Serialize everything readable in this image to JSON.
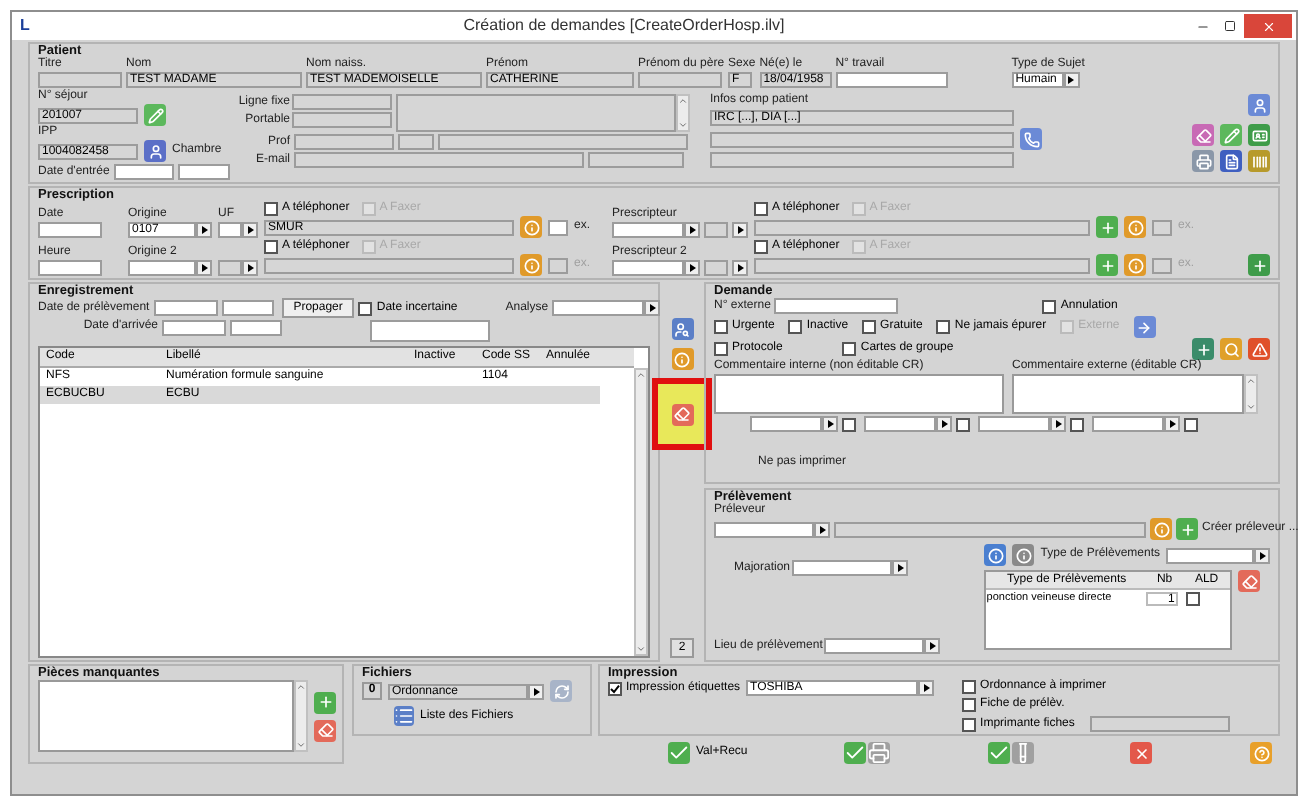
{
  "window": {
    "logo": "L",
    "title": "Création de demandes [CreateOrderHosp.ilv]"
  },
  "patient": {
    "heading": "Patient",
    "titre": {
      "label": "Titre"
    },
    "nom": {
      "label": "Nom",
      "value": "TEST MADAME"
    },
    "nom_naiss": {
      "label": "Nom naiss.",
      "value": "TEST MADEMOISELLE"
    },
    "prenom": {
      "label": "Prénom",
      "value": "CATHERINE"
    },
    "prenom_pere": {
      "label": "Prénom du père"
    },
    "sexe": {
      "label": "Sexe",
      "value": "F"
    },
    "naissance": {
      "label": "Né(e) le",
      "value": "18/04/1958"
    },
    "travail": {
      "label": "N° travail"
    },
    "type_sujet": {
      "label": "Type de Sujet",
      "value": "Humain"
    },
    "sejour": {
      "label": "N° séjour",
      "value": "201007"
    },
    "ipp": {
      "label": "IPP",
      "value": "1004082458"
    },
    "chambre": {
      "label": "Chambre"
    },
    "date_entree": {
      "label": "Date d'entrée"
    },
    "ligne_fixe": {
      "label": "Ligne fixe"
    },
    "portable": {
      "label": "Portable"
    },
    "prof": {
      "label": "Prof"
    },
    "email": {
      "label": "E-mail"
    },
    "infos": {
      "label": "Infos comp patient",
      "value": "IRC [...], DIA [...]"
    }
  },
  "prescription": {
    "heading": "Prescription",
    "rows": [
      {
        "date_label": "Date",
        "origine_label": "Origine",
        "uf_label": "UF",
        "origine_value": "0107",
        "phone": {
          "label": "A téléphoner",
          "checked": false,
          "disabled": false
        },
        "fax": {
          "label": "A Faxer",
          "checked": false,
          "disabled": true
        },
        "service": "SMUR",
        "ex": "ex."
      },
      {
        "date_label": "Heure",
        "origine_label": "Origine 2",
        "phone": {
          "label": "A téléphoner",
          "checked": false,
          "disabled": false
        },
        "fax": {
          "label": "A Faxer",
          "checked": false,
          "disabled": true
        },
        "ex": "ex."
      }
    ],
    "prescripteurs": [
      {
        "label": "Prescripteur",
        "phone": {
          "label": "A téléphoner",
          "checked": false,
          "disabled": false
        },
        "fax": {
          "label": "A Faxer",
          "checked": false,
          "disabled": true
        },
        "ex": "ex."
      },
      {
        "label": "Prescripteur 2",
        "phone": {
          "label": "A téléphoner",
          "checked": false,
          "disabled": false
        },
        "fax": {
          "label": "A Faxer",
          "checked": false,
          "disabled": true
        },
        "ex": "ex."
      }
    ]
  },
  "enregistrement": {
    "heading": "Enregistrement",
    "date_prelevement": "Date de prélèvement",
    "propager": "Propager",
    "date_incertaine": {
      "label": "Date incertaine",
      "checked": false
    },
    "analyse": "Analyse",
    "date_arrivee": "Date d'arrivée",
    "table": {
      "columns": [
        "Code",
        "Libellé",
        "Inactive",
        "Code SS",
        "Annulée"
      ],
      "rows": [
        {
          "code": "NFS",
          "libelle": "Numération formule sanguine",
          "code_ss": "1104",
          "selected": false
        },
        {
          "code": "ECBUCBU",
          "libelle": "ECBU",
          "selected": true
        }
      ]
    },
    "count": "2"
  },
  "demande": {
    "heading": "Demande",
    "externe": "N° externe",
    "annulation": {
      "label": "Annulation",
      "checked": false,
      "disabled": false
    },
    "row_2": [
      {
        "label": "Urgente",
        "checked": false,
        "disabled": false
      },
      {
        "label": "Inactive",
        "checked": false,
        "disabled": false
      },
      {
        "label": "Gratuite",
        "checked": false,
        "disabled": false
      },
      {
        "label": "Ne jamais épurer",
        "checked": false,
        "disabled": false
      },
      {
        "label": "Externe",
        "checked": false,
        "disabled": true
      }
    ],
    "row_3": [
      {
        "label": "Protocole",
        "checked": false,
        "disabled": false
      },
      {
        "label": "Cartes de groupe",
        "checked": false,
        "disabled": false
      }
    ],
    "comment_internal": "Commentaire interne (non éditable CR)",
    "comment_external": "Commentaire externe (éditable CR)",
    "print_options": [
      {
        "checked": false
      },
      {
        "checked": false
      },
      {
        "checked": false
      },
      {
        "checked": false
      }
    ],
    "ne_pas_imprimer": "Ne pas imprimer"
  },
  "prelevement": {
    "heading": "Prélèvement",
    "preleveur": "Préleveur",
    "creer": "Créer préleveur ...",
    "majoration": "Majoration",
    "type": "Type de Prélèvements",
    "table": {
      "columns": [
        "Type de Prélèvements",
        "Nb",
        "ALD"
      ],
      "rows": [
        {
          "type": "ponction veineuse directe",
          "nb": "1",
          "ald": false
        }
      ]
    },
    "lieu": "Lieu de prélèvement"
  },
  "pieces": {
    "heading": "Pièces manquantes"
  },
  "fichiers": {
    "heading": "Fichiers",
    "count": "0",
    "type": "Ordonnance",
    "liste": "Liste des Fichiers"
  },
  "impression": {
    "heading": "Impression",
    "etiquettes": {
      "label": "Impression étiquettes",
      "checked": true
    },
    "printer": "TOSHIBA",
    "ordonnance": {
      "label": "Ordonnance à imprimer",
      "checked": false
    },
    "fiche": {
      "label": "Fiche de prélèv.",
      "checked": false
    },
    "imprimante": {
      "label": "Imprimante fiches",
      "checked": false
    }
  },
  "footer": {
    "validate": "Val+Recu"
  }
}
